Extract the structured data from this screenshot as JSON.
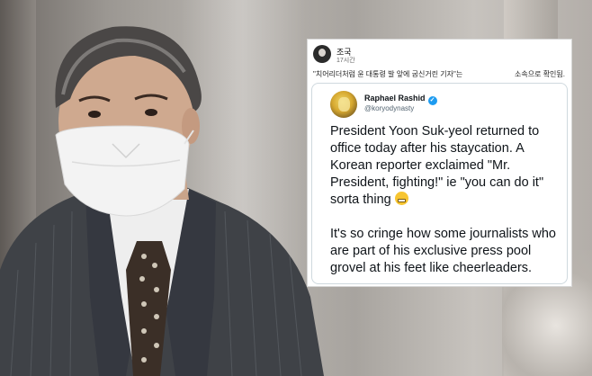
{
  "post": {
    "author": "조국",
    "time": "17시간",
    "caption_left": "\"치어리더처럼 윤 대통령 발 앞에 굽신거린 기자\"는",
    "caption_right": "소속으로 확인됨."
  },
  "tweet": {
    "name": "Raphael Rashid",
    "handle": "@koryodynasty",
    "verified_icon": "verified-badge-icon",
    "paragraph1": "President Yoon Suk-yeol returned to office today after his staycation. A Korean reporter exclaimed \"Mr. President, fighting!\" ie \"you can do it\" sorta thing",
    "emoji": "grimacing-face-icon",
    "paragraph2": "It's so cringe how some journalists who are part of his exclusive press pool grovel at his feet like cheerleaders."
  }
}
